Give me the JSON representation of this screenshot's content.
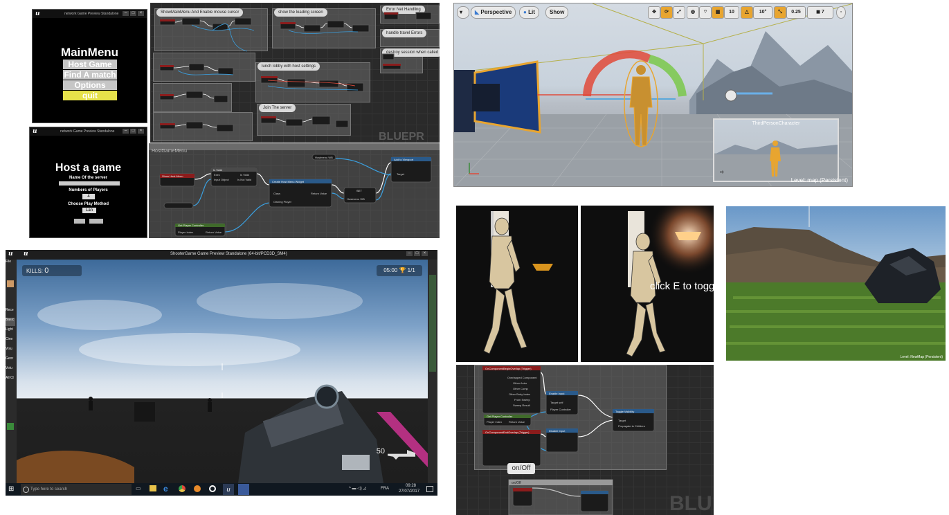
{
  "panel_main_menu": {
    "titlebar": "network Game Preview Standalone",
    "heading": "MainMenu",
    "buttons": [
      "Host Game",
      "Find A match",
      "Options",
      "quit"
    ]
  },
  "panel_host_game": {
    "titlebar": "network Game Preview Standalone",
    "heading": "Host a game",
    "server_name_label": "Name Of the server",
    "players_label": "Numbers of Players",
    "players_value": "4",
    "play_method_label": "Choose Play Method",
    "play_method_value": "Lan"
  },
  "panel_blueprint_top": {
    "comments": [
      "ShowMainMenu And Enable mouse cursor",
      "show the loading screen",
      "Error Net Handling",
      "handle travel Errors",
      "destroy session when called",
      "lunch lobby with host settings",
      "Join The server",
      "BLUEPR"
    ]
  },
  "panel_host_menu_graph": {
    "comment": "HostGameMenu",
    "nodes": [
      "Show Host Menu",
      "Is Valid",
      "Exec",
      "Input Object",
      "Is Valid",
      "Is Not Valid",
      "Create Host Menu Widget",
      "Class",
      "Return Value",
      "Owning Player",
      "SET",
      "Hostmenu WB",
      "Add to Viewport",
      "Target",
      "Get Player Controller",
      "Player Index",
      "Return Value",
      "Hostmenu WB"
    ]
  },
  "panel_viewport": {
    "buttons": [
      "Perspective",
      "Lit",
      "Show"
    ],
    "grid_value": "10",
    "rot_value": "10°",
    "scale_value": "0.25",
    "cam_speed": "7",
    "preview_title": "ThirdPersonCharacter",
    "level_label": "Level: map (Persistent)"
  },
  "panel_game": {
    "titlebar": "ShooterGame Game Preview Standalone (64-bit/PCD3D_SM4)",
    "kills_label": "KILLS:",
    "kills_value": "0",
    "timer": "05:00",
    "score": "1/1",
    "ammo_value": "50",
    "side_tabs": [
      "File",
      "Rece",
      "Basic",
      "Light",
      "Cine",
      "Visu",
      "Geor",
      "Volu",
      "All Cl"
    ],
    "taskbar": {
      "search_placeholder": "Type here to search",
      "time": "09:28",
      "date": "27/07/2017",
      "lang": "FRA"
    }
  },
  "panel_light_off": {},
  "panel_light_on": {
    "overlay_text": "click E to toggl"
  },
  "panel_landscape": {
    "level_label": "Level: NewMap (Persistent)"
  },
  "panel_toggle_graph": {
    "nodes": [
      "OnComponentBeginOverlap (Trigger)",
      "Overlapped Component",
      "Other Actor",
      "Other Comp",
      "Other Body Index",
      "From Sweep",
      "Sweep Result",
      "Enable Input",
      "Target self",
      "Player Controller",
      "Get Player Controller",
      "Player Index",
      "Return Value",
      "OnComponentEndOverlap (Trigger)",
      "Disable Input",
      "Toggle Visibility",
      "Target",
      "Propagate to Children"
    ],
    "comment_label": "on/Off",
    "sub_comment": "on/Off",
    "watermark": "BLU"
  },
  "colors": {
    "blueprint_bg": "#2a2a2a",
    "exec_wire": "#ffffff",
    "object_wire": "#3aa0e0",
    "quit_button": "#e6e24a",
    "gizmo_red": "#e04a3a",
    "gizmo_green": "#7ac84a",
    "character_orange": "#e8a530"
  }
}
